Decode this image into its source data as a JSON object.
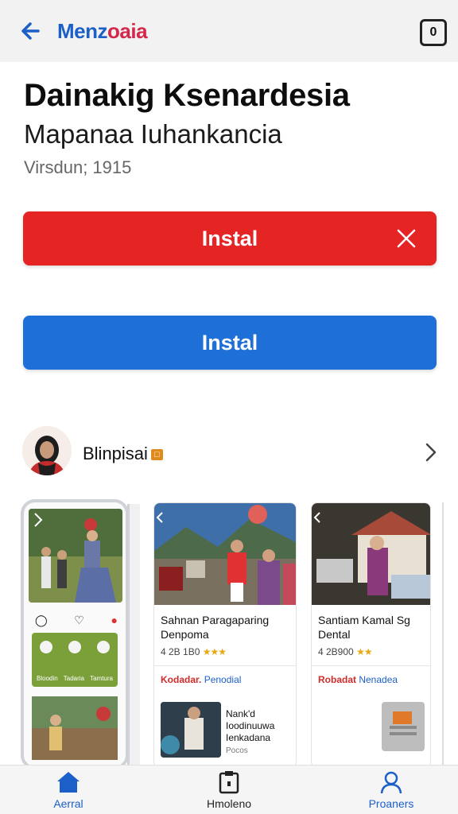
{
  "topbar": {
    "brand_part1": "Menz",
    "brand_part2": "oaia",
    "right_icon_glyph": "0"
  },
  "app": {
    "title": "Dainakig Ksenardesia",
    "subtitle": "Mapanaa Iuhankancia",
    "version": "Virsdun; 1915"
  },
  "buttons": {
    "install_red": "Instal",
    "install_blue": "Instal"
  },
  "developer": {
    "name": "Blinpisai",
    "badge": "□"
  },
  "screenshots": {
    "card1": {
      "title": "Sahnan Paragaparing Denpoma",
      "rating": "4 2B 1B0",
      "stars": "★★★",
      "link_red": "Kodadar.",
      "link_blue": "Penodial",
      "mini_title": "Nank'd Ioodinuuwa Ienkadana",
      "mini_sub": "Pocos"
    },
    "card2": {
      "title": "Santiam Kamal Sg Dental",
      "rating": "4 2B900",
      "stars": "★★",
      "link_red": "Robadat",
      "link_blue": "Nenadea"
    },
    "phone": {
      "green_labels": [
        "Bloodin",
        "Tadaria",
        "Tamtura"
      ]
    }
  },
  "bottom_nav": {
    "home": "Aerral",
    "middle": "Hmoleno",
    "profile": "Proaners"
  },
  "colors": {
    "red": "#e52424",
    "blue": "#1f6fd8",
    "brand_blue": "#1c5fc9",
    "brand_red": "#d3284a"
  }
}
